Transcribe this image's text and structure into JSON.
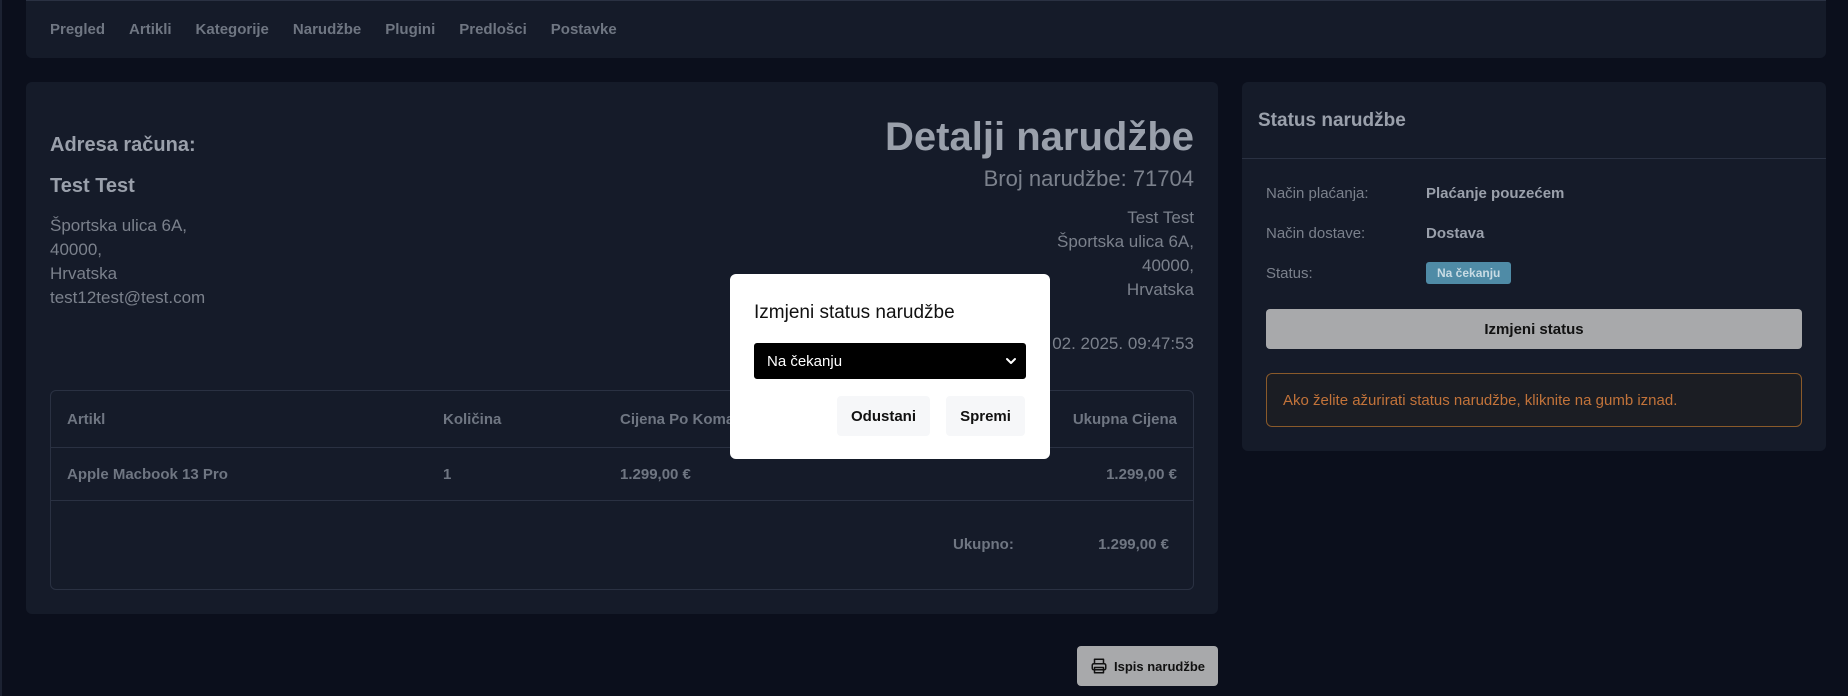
{
  "nav": {
    "items": [
      "Pregled",
      "Artikli",
      "Kategorije",
      "Narudžbe",
      "Plugini",
      "Predlošci",
      "Postavke"
    ]
  },
  "order": {
    "billing_title": "Adresa računa:",
    "billing_name": "Test Test",
    "billing_lines": [
      "Športska ulica 6A,",
      "40000,",
      "Hrvatska",
      "test12test@test.com"
    ],
    "detail_title": "Detalji narudžbe",
    "order_number": "Broj narudžbe: 71704",
    "shipping_lines": [
      "Test Test",
      "Športska ulica 6A,",
      "40000,",
      "Hrvatska"
    ],
    "date_visible": "02. 2025. 09:47:53"
  },
  "table": {
    "headers": [
      "Artikl",
      "Količina",
      "Cijena Po Komad",
      "Ukupna Cijena"
    ],
    "rows": [
      {
        "item": "Apple Macbook 13 Pro",
        "qty": "1",
        "unit_price": "1.299,00 €",
        "total": "1.299,00 €"
      }
    ],
    "total_label": "Ukupno:",
    "total_value": "1.299,00 €"
  },
  "print_button": {
    "label": "Ispis narudžbe",
    "icon": "printer-icon"
  },
  "status_panel": {
    "title": "Status narudžbe",
    "payment_label": "Način plaćanja:",
    "payment_value": "Plaćanje pouzećem",
    "delivery_label": "Način dostave:",
    "delivery_value": "Dostava",
    "status_label": "Status:",
    "status_badge": "Na čekanju",
    "change_button": "Izmjeni status",
    "hint": "Ako želite ažurirati status narudžbe, kliknite na gumb iznad."
  },
  "modal": {
    "title": "Izmjeni status narudžbe",
    "selected": "Na čekanju",
    "cancel": "Odustani",
    "save": "Spremi"
  },
  "colors": {
    "background": "#0b0f1c",
    "card": "#151b29",
    "badge": "#4f8ba6",
    "warning": "#c2733a"
  }
}
